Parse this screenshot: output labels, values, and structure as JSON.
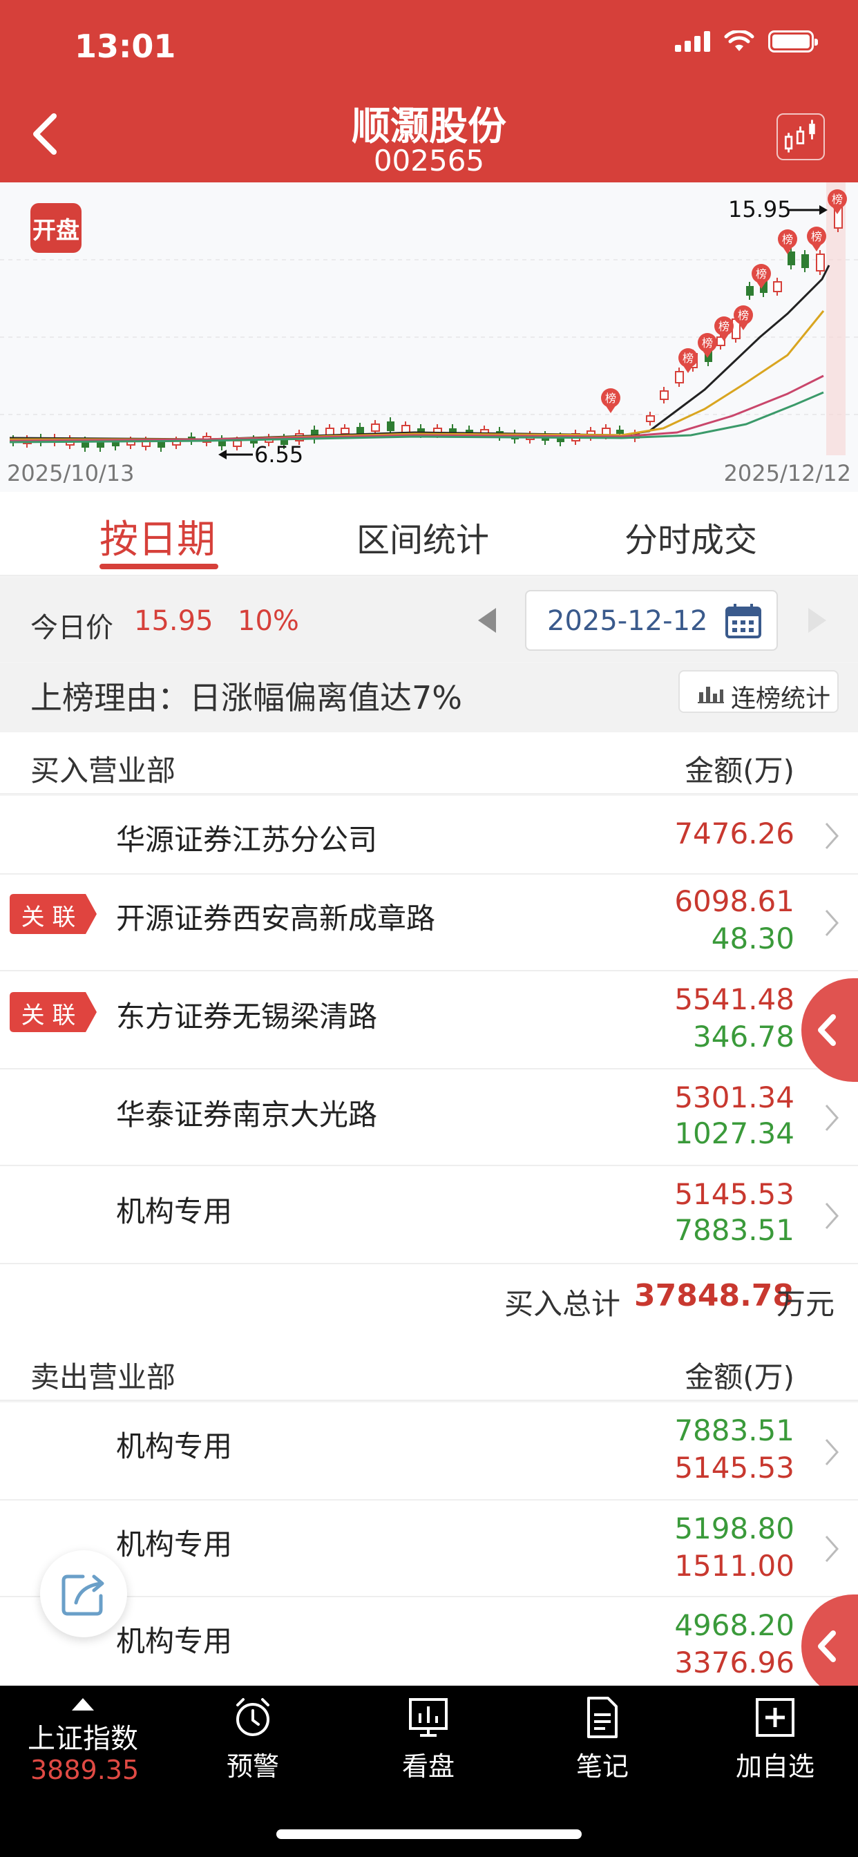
{
  "status_bar": {
    "time": "13:01"
  },
  "header": {
    "title": "顺灏股份",
    "code": "002565"
  },
  "chart": {
    "badge": "开盘",
    "start_date": "2025/10/13",
    "end_date": "2025/12/12",
    "high_label": "15.95",
    "low_label": "6.55",
    "list_marker": "榜",
    "colors": {
      "up": "#d6403a",
      "down": "#2e7d32",
      "ma_dark": "#222222",
      "ma_yellow": "#d9a520",
      "ma_pink": "#c9466b",
      "ma_green": "#3b9a6a"
    }
  },
  "tabs": [
    {
      "label": "按日期",
      "active": true
    },
    {
      "label": "区间统计",
      "active": false
    },
    {
      "label": "分时成交",
      "active": false
    }
  ],
  "price": {
    "label": "今日价",
    "value": "15.95",
    "change_pct": "10%",
    "date": "2025-12-12"
  },
  "reason": {
    "text": "上榜理由：日涨幅偏离值达7%",
    "stats_button": "连榜统计"
  },
  "buy_section": {
    "label": "买入营业部",
    "amount_header": "金额(万)",
    "rows": [
      {
        "name": "华源证券江苏分公司",
        "buy": "7476.26",
        "sell": "",
        "tag": ""
      },
      {
        "name": "开源证券西安高新成章路",
        "buy": "6098.61",
        "sell": "48.30",
        "tag": "关 联"
      },
      {
        "name": "东方证券无锡梁清路",
        "buy": "5541.48",
        "sell": "346.78",
        "tag": "关 联"
      },
      {
        "name": "华泰证券南京大光路",
        "buy": "5301.34",
        "sell": "1027.34",
        "tag": ""
      },
      {
        "name": "机构专用",
        "buy": "5145.53",
        "sell": "7883.51",
        "tag": ""
      }
    ],
    "total_label": "买入总计",
    "total_value": "37848.78",
    "total_unit": "万元"
  },
  "sell_section": {
    "label": "卖出营业部",
    "amount_header": "金额(万)",
    "rows": [
      {
        "name": "机构专用",
        "sell": "7883.51",
        "buy": "5145.53"
      },
      {
        "name": "机构专用",
        "sell": "5198.80",
        "buy": "1511.00"
      },
      {
        "name": "机构专用",
        "sell": "4968.20",
        "buy": "3376.96"
      }
    ]
  },
  "bottom_nav": {
    "index_name": "上证指数",
    "index_value": "3889.35",
    "items": [
      {
        "label": "预警",
        "icon": "alarm-clock-icon"
      },
      {
        "label": "看盘",
        "icon": "monitor-chart-icon"
      },
      {
        "label": "笔记",
        "icon": "note-icon"
      },
      {
        "label": "加自选",
        "icon": "add-square-icon"
      }
    ]
  }
}
